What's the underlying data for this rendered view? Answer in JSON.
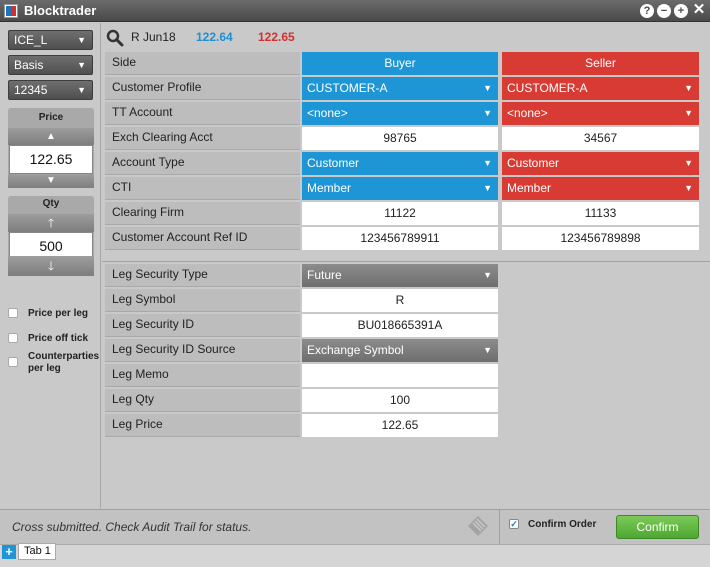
{
  "app": {
    "title": "Blocktrader"
  },
  "left": {
    "exchange": "ICE_L",
    "strategy": "Basis",
    "account": "12345",
    "price_label": "Price",
    "price_value": "122.65",
    "qty_label": "Qty",
    "qty_value": "500",
    "options": [
      {
        "label": "Price per leg"
      },
      {
        "label": "Price off tick"
      },
      {
        "label": "Counterparties per leg"
      }
    ]
  },
  "header": {
    "instrument": "R Jun18",
    "bid": "122.64",
    "ask": "122.65"
  },
  "parties": {
    "rows": [
      {
        "label": "Side",
        "buyer": "Buyer",
        "seller": "Seller"
      },
      {
        "label": "Customer Profile",
        "buyer": "CUSTOMER-A",
        "seller": "CUSTOMER-A"
      },
      {
        "label": "TT Account",
        "buyer": "<none>",
        "seller": "<none>"
      },
      {
        "label": "Exch Clearing Acct",
        "buyer": "98765",
        "seller": "34567"
      },
      {
        "label": "Account Type",
        "buyer": "Customer",
        "seller": "Customer"
      },
      {
        "label": "CTI",
        "buyer": "Member",
        "seller": "Member"
      },
      {
        "label": "Clearing Firm",
        "buyer": "11122",
        "seller": "11133"
      },
      {
        "label": "Customer Account Ref ID",
        "buyer": "123456789911",
        "seller": "123456789898"
      }
    ]
  },
  "leg": {
    "rows": [
      {
        "label": "Leg Security Type",
        "value": "Future"
      },
      {
        "label": "Leg Symbol",
        "value": "R"
      },
      {
        "label": "Leg Security ID",
        "value": "BU018665391A"
      },
      {
        "label": "Leg Security ID Source",
        "value": "Exchange Symbol"
      },
      {
        "label": "Leg Memo",
        "value": ""
      },
      {
        "label": "Leg Qty",
        "value": "100"
      },
      {
        "label": "Leg Price",
        "value": "122.65"
      }
    ]
  },
  "footer": {
    "status": "Cross submitted. Check Audit Trail for status.",
    "confirm_order_label": "Confirm Order",
    "confirm_button": "Confirm"
  },
  "tabs": [
    {
      "label": "Tab 1"
    }
  ]
}
